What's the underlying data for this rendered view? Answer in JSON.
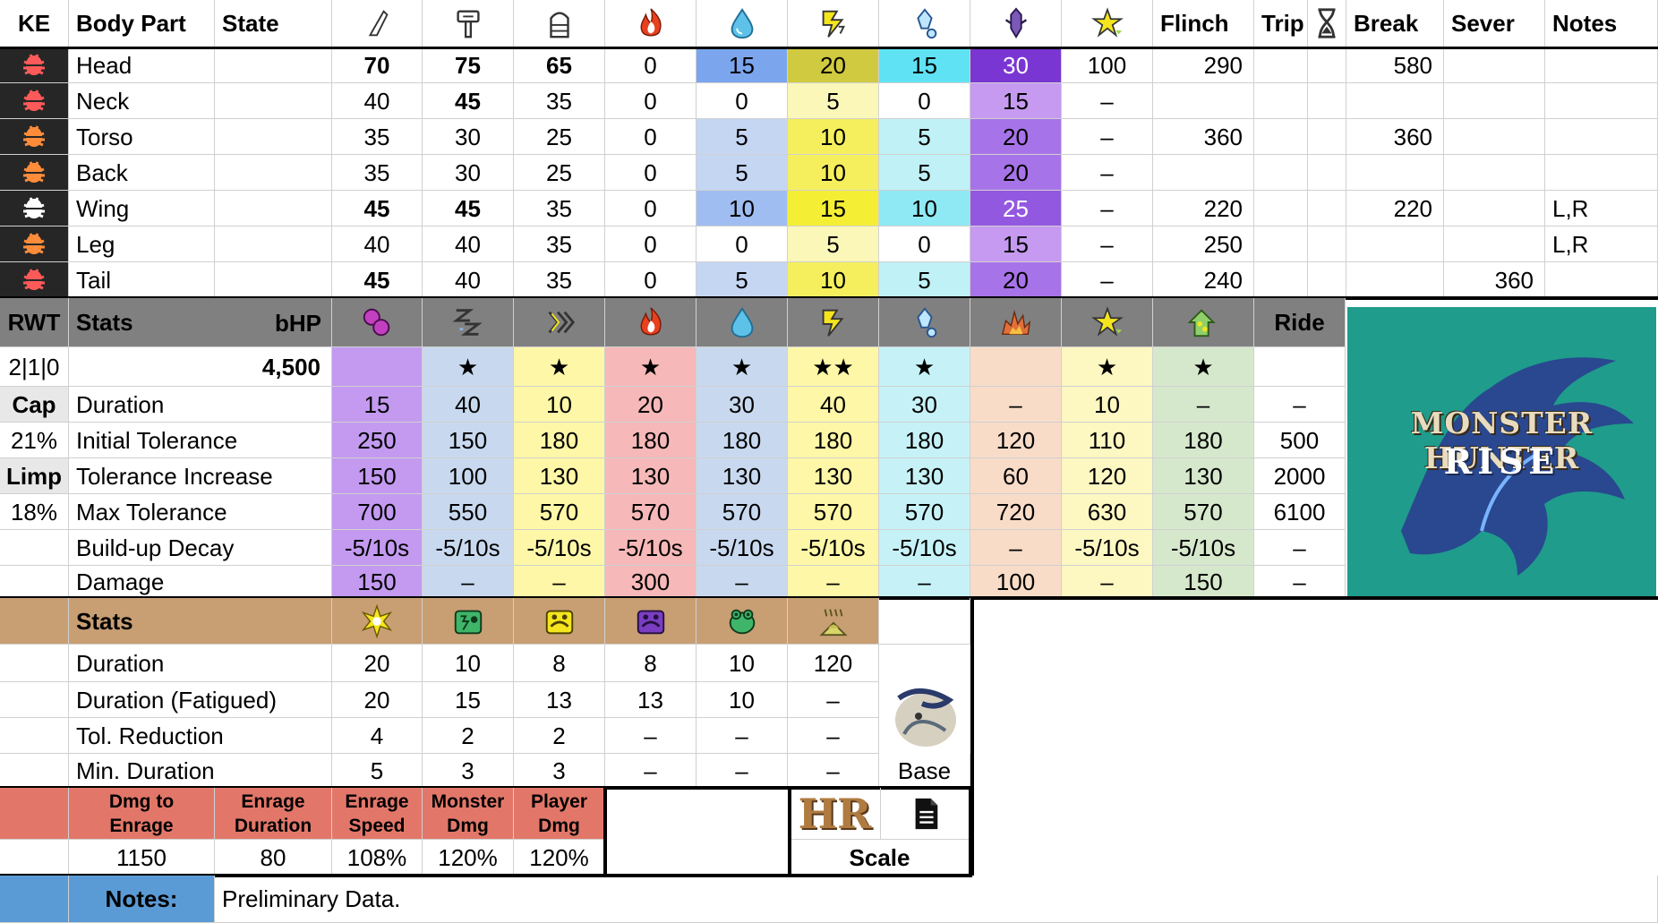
{
  "colors": {
    "header_gray": "#808080",
    "header_tan": "#c89e73",
    "enrage_red": "#e27769",
    "notes_blue": "#5b9bd5",
    "ke_dark": "#262626",
    "logo_teal": "#1f9c8c"
  },
  "top": {
    "headers": {
      "ke": "KE",
      "part": "Body Part",
      "state": "State",
      "cut": "cut-icon",
      "blunt": "blunt-icon",
      "shot": "shot-icon",
      "fire": "fire-icon",
      "water": "water-icon",
      "thunder": "thunder-icon",
      "ice": "ice-icon",
      "dragon": "dragon-icon",
      "stun": "stun-icon",
      "flinch": "Flinch",
      "trip": "Trip",
      "hourglass": "hourglass-icon",
      "break": "Break",
      "sever": "Sever",
      "notes": "Notes"
    },
    "rows": [
      {
        "ke_color": "#ff5a5a",
        "part": "Head",
        "cut": "70",
        "blunt": "75",
        "shot": "65",
        "fire": "0",
        "water": "15",
        "thunder": "20",
        "ice": "15",
        "dragon": "30",
        "stun": "100",
        "flinch": "290",
        "break": "580",
        "sever": "",
        "notes": ""
      },
      {
        "ke_color": "#ff5a5a",
        "part": "Neck",
        "cut": "40",
        "blunt": "45",
        "shot": "35",
        "fire": "0",
        "water": "0",
        "thunder": "5",
        "ice": "0",
        "dragon": "15",
        "stun": "–",
        "flinch": "",
        "break": "",
        "sever": "",
        "notes": ""
      },
      {
        "ke_color": "#ff8c3a",
        "part": "Torso",
        "cut": "35",
        "blunt": "30",
        "shot": "25",
        "fire": "0",
        "water": "5",
        "thunder": "10",
        "ice": "5",
        "dragon": "20",
        "stun": "–",
        "flinch": "360",
        "break": "360",
        "sever": "",
        "notes": ""
      },
      {
        "ke_color": "#ff8c3a",
        "part": "Back",
        "cut": "35",
        "blunt": "30",
        "shot": "25",
        "fire": "0",
        "water": "5",
        "thunder": "10",
        "ice": "5",
        "dragon": "20",
        "stun": "–",
        "flinch": "",
        "break": "",
        "sever": "",
        "notes": ""
      },
      {
        "ke_color": "#ffffff",
        "part": "Wing",
        "cut": "45",
        "blunt": "45",
        "shot": "35",
        "fire": "0",
        "water": "10",
        "thunder": "15",
        "ice": "10",
        "dragon": "25",
        "stun": "–",
        "flinch": "220",
        "break": "220",
        "sever": "",
        "notes": "L,R"
      },
      {
        "ke_color": "#ff8c3a",
        "part": "Leg",
        "cut": "40",
        "blunt": "40",
        "shot": "35",
        "fire": "0",
        "water": "0",
        "thunder": "5",
        "ice": "0",
        "dragon": "15",
        "stun": "–",
        "flinch": "250",
        "break": "",
        "sever": "",
        "notes": "L,R"
      },
      {
        "ke_color": "#ff5a5a",
        "part": "Tail",
        "cut": "45",
        "blunt": "40",
        "shot": "35",
        "fire": "0",
        "water": "5",
        "thunder": "10",
        "ice": "5",
        "dragon": "20",
        "stun": "–",
        "flinch": "240",
        "break": "",
        "sever": "360",
        "notes": ""
      }
    ]
  },
  "ailments": {
    "rwt": "RWT",
    "stats": "Stats",
    "bhp": "bHP",
    "ride": "Ride",
    "icons": [
      "poison-icon",
      "sleep-icon",
      "paralysis-icon",
      "fire-blight-icon",
      "water-blight-icon",
      "thunder-blight-icon",
      "ice-blight-icon",
      "blast-icon",
      "stun-icon",
      "exhaust-icon"
    ],
    "left": [
      "2|1|0",
      "Cap",
      "21%",
      "Limp",
      "18%",
      "",
      ""
    ],
    "hp": "4,500",
    "stars": [
      "",
      "★",
      "★",
      "★",
      "★",
      "★★",
      "★",
      "",
      "★",
      "★",
      ""
    ],
    "rows": [
      {
        "label": "Duration",
        "vals": [
          "15",
          "40",
          "10",
          "20",
          "30",
          "40",
          "30",
          "–",
          "10",
          "–",
          "–"
        ]
      },
      {
        "label": "Initial Tolerance",
        "vals": [
          "250",
          "150",
          "180",
          "180",
          "180",
          "180",
          "180",
          "120",
          "110",
          "180",
          "500"
        ]
      },
      {
        "label": "Tolerance Increase",
        "vals": [
          "150",
          "100",
          "130",
          "130",
          "130",
          "130",
          "130",
          "60",
          "120",
          "130",
          "2000"
        ]
      },
      {
        "label": "Max Tolerance",
        "vals": [
          "700",
          "550",
          "570",
          "570",
          "570",
          "570",
          "570",
          "720",
          "630",
          "570",
          "6100"
        ]
      },
      {
        "label": "Build-up Decay",
        "vals": [
          "-5/10s",
          "-5/10s",
          "-5/10s",
          "-5/10s",
          "-5/10s",
          "-5/10s",
          "-5/10s",
          "–",
          "-5/10s",
          "-5/10s",
          "–"
        ]
      },
      {
        "label": "Damage",
        "vals": [
          "150",
          "–",
          "–",
          "300",
          "–",
          "–",
          "–",
          "100",
          "–",
          "150",
          "–"
        ]
      }
    ]
  },
  "logo": {
    "line1": "MONSTER HUNTER",
    "line2": "RISE"
  },
  "items": {
    "stats": "Stats",
    "icons": [
      "flash-bomb-icon",
      "shock-trap-icon",
      "pitfall-trap-icon",
      "pitfall-trap-purple-icon",
      "frog-trap-icon",
      "dung-bomb-icon"
    ],
    "base": "Base",
    "rows": [
      {
        "label": "Duration",
        "vals": [
          "20",
          "10",
          "8",
          "8",
          "10",
          "120"
        ]
      },
      {
        "label": "Duration (Fatigued)",
        "vals": [
          "20",
          "15",
          "13",
          "13",
          "10",
          "–"
        ]
      },
      {
        "label": "Tol. Reduction",
        "vals": [
          "4",
          "2",
          "2",
          "–",
          "–",
          "–"
        ]
      },
      {
        "label": "Min. Duration",
        "vals": [
          "5",
          "3",
          "3",
          "–",
          "–",
          "–"
        ]
      }
    ]
  },
  "enrage": {
    "headers": [
      [
        "Dmg to",
        "Enrage"
      ],
      [
        "Enrage",
        "Duration"
      ],
      [
        "Enrage",
        "Speed"
      ],
      [
        "Monster",
        "Dmg"
      ],
      [
        "Player",
        "Dmg"
      ]
    ],
    "values": [
      "1150",
      "80",
      "108%",
      "120%",
      "120%"
    ]
  },
  "hr": {
    "label": "HR",
    "scale": "Scale",
    "icon": "document-icon"
  },
  "notes": {
    "label": "Notes:",
    "text": "Preliminary Data."
  }
}
